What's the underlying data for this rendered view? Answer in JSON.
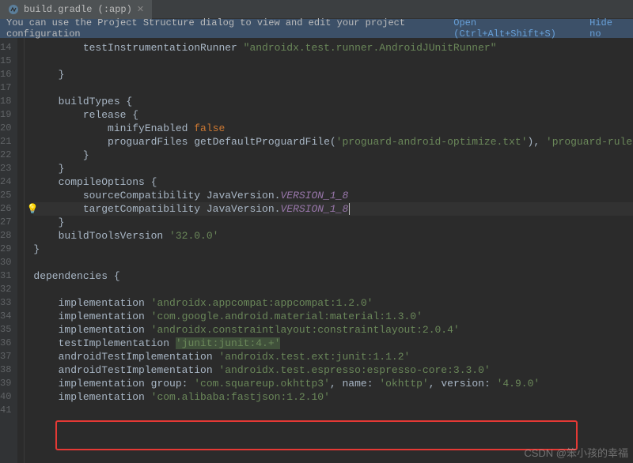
{
  "tab": {
    "label": "build.gradle (:app)"
  },
  "infobar": {
    "message": "You can use the Project Structure dialog to view and edit your project configuration",
    "open_label": "Open (Ctrl+Alt+Shift+S)",
    "hide_label": "Hide no"
  },
  "gutter": {
    "start": 14,
    "end": 41,
    "bulb_line": 26
  },
  "line_14": {
    "t1": "        testInstrumentationRunner ",
    "s1": "\"androidx.test.runner.AndroidJUnitRunner\""
  },
  "line_16": {
    "t1": "    }"
  },
  "line_18": {
    "t1": "    buildTypes {"
  },
  "line_19": {
    "t1": "        release {"
  },
  "line_20": {
    "t1": "            minifyEnabled ",
    "kw": "false"
  },
  "line_21": {
    "t1": "            proguardFiles getDefaultProguardFile(",
    "s1": "'proguard-android-optimize.txt'",
    "t2": "), ",
    "s2": "'proguard-rules.pro'"
  },
  "line_22": {
    "t1": "        }"
  },
  "line_23": {
    "t1": "    }"
  },
  "line_24": {
    "t1": "    compileOptions {"
  },
  "line_25": {
    "t1": "        sourceCompatibility JavaVersion.",
    "c1": "VERSION_1_8"
  },
  "line_26": {
    "t1": "        targetCompatibility JavaVersion.",
    "c1": "VERSION_1_8"
  },
  "line_27": {
    "t1": "    }"
  },
  "line_28": {
    "t1": "    buildToolsVersion ",
    "s1": "'32.0.0'"
  },
  "line_29": {
    "t1": "}"
  },
  "line_31": {
    "t1": "dependencies {"
  },
  "line_33": {
    "t1": "    implementation ",
    "s1": "'androidx.appcompat:appcompat:1.2.0'"
  },
  "line_34": {
    "t1": "    implementation ",
    "s1": "'com.google.android.material:material:1.3.0'"
  },
  "line_35": {
    "t1": "    implementation ",
    "s1": "'androidx.constraintlayout:constraintlayout:2.0.4'"
  },
  "line_36": {
    "t1": "    testImplementation ",
    "s1": "'junit:junit:4.+'"
  },
  "line_37": {
    "t1": "    androidTestImplementation ",
    "s1": "'androidx.test.ext:junit:1.1.2'"
  },
  "line_38": {
    "t1": "    androidTestImplementation ",
    "s1": "'androidx.test.espresso:espresso-core:3.3.0'"
  },
  "line_39": {
    "t1": "    implementation ",
    "t2": "group: ",
    "s1": "'com.squareup.okhttp3'",
    "t3": ", name: ",
    "s2": "'okhttp'",
    "t4": ", version: ",
    "s3": "'4.9.0'"
  },
  "line_40": {
    "t1": "    implementation ",
    "s1": "'com.alibaba:fastjson:1.2.10'"
  },
  "line_41": {
    "t1": ""
  },
  "watermark": "CSDN @笨小孩的幸福"
}
